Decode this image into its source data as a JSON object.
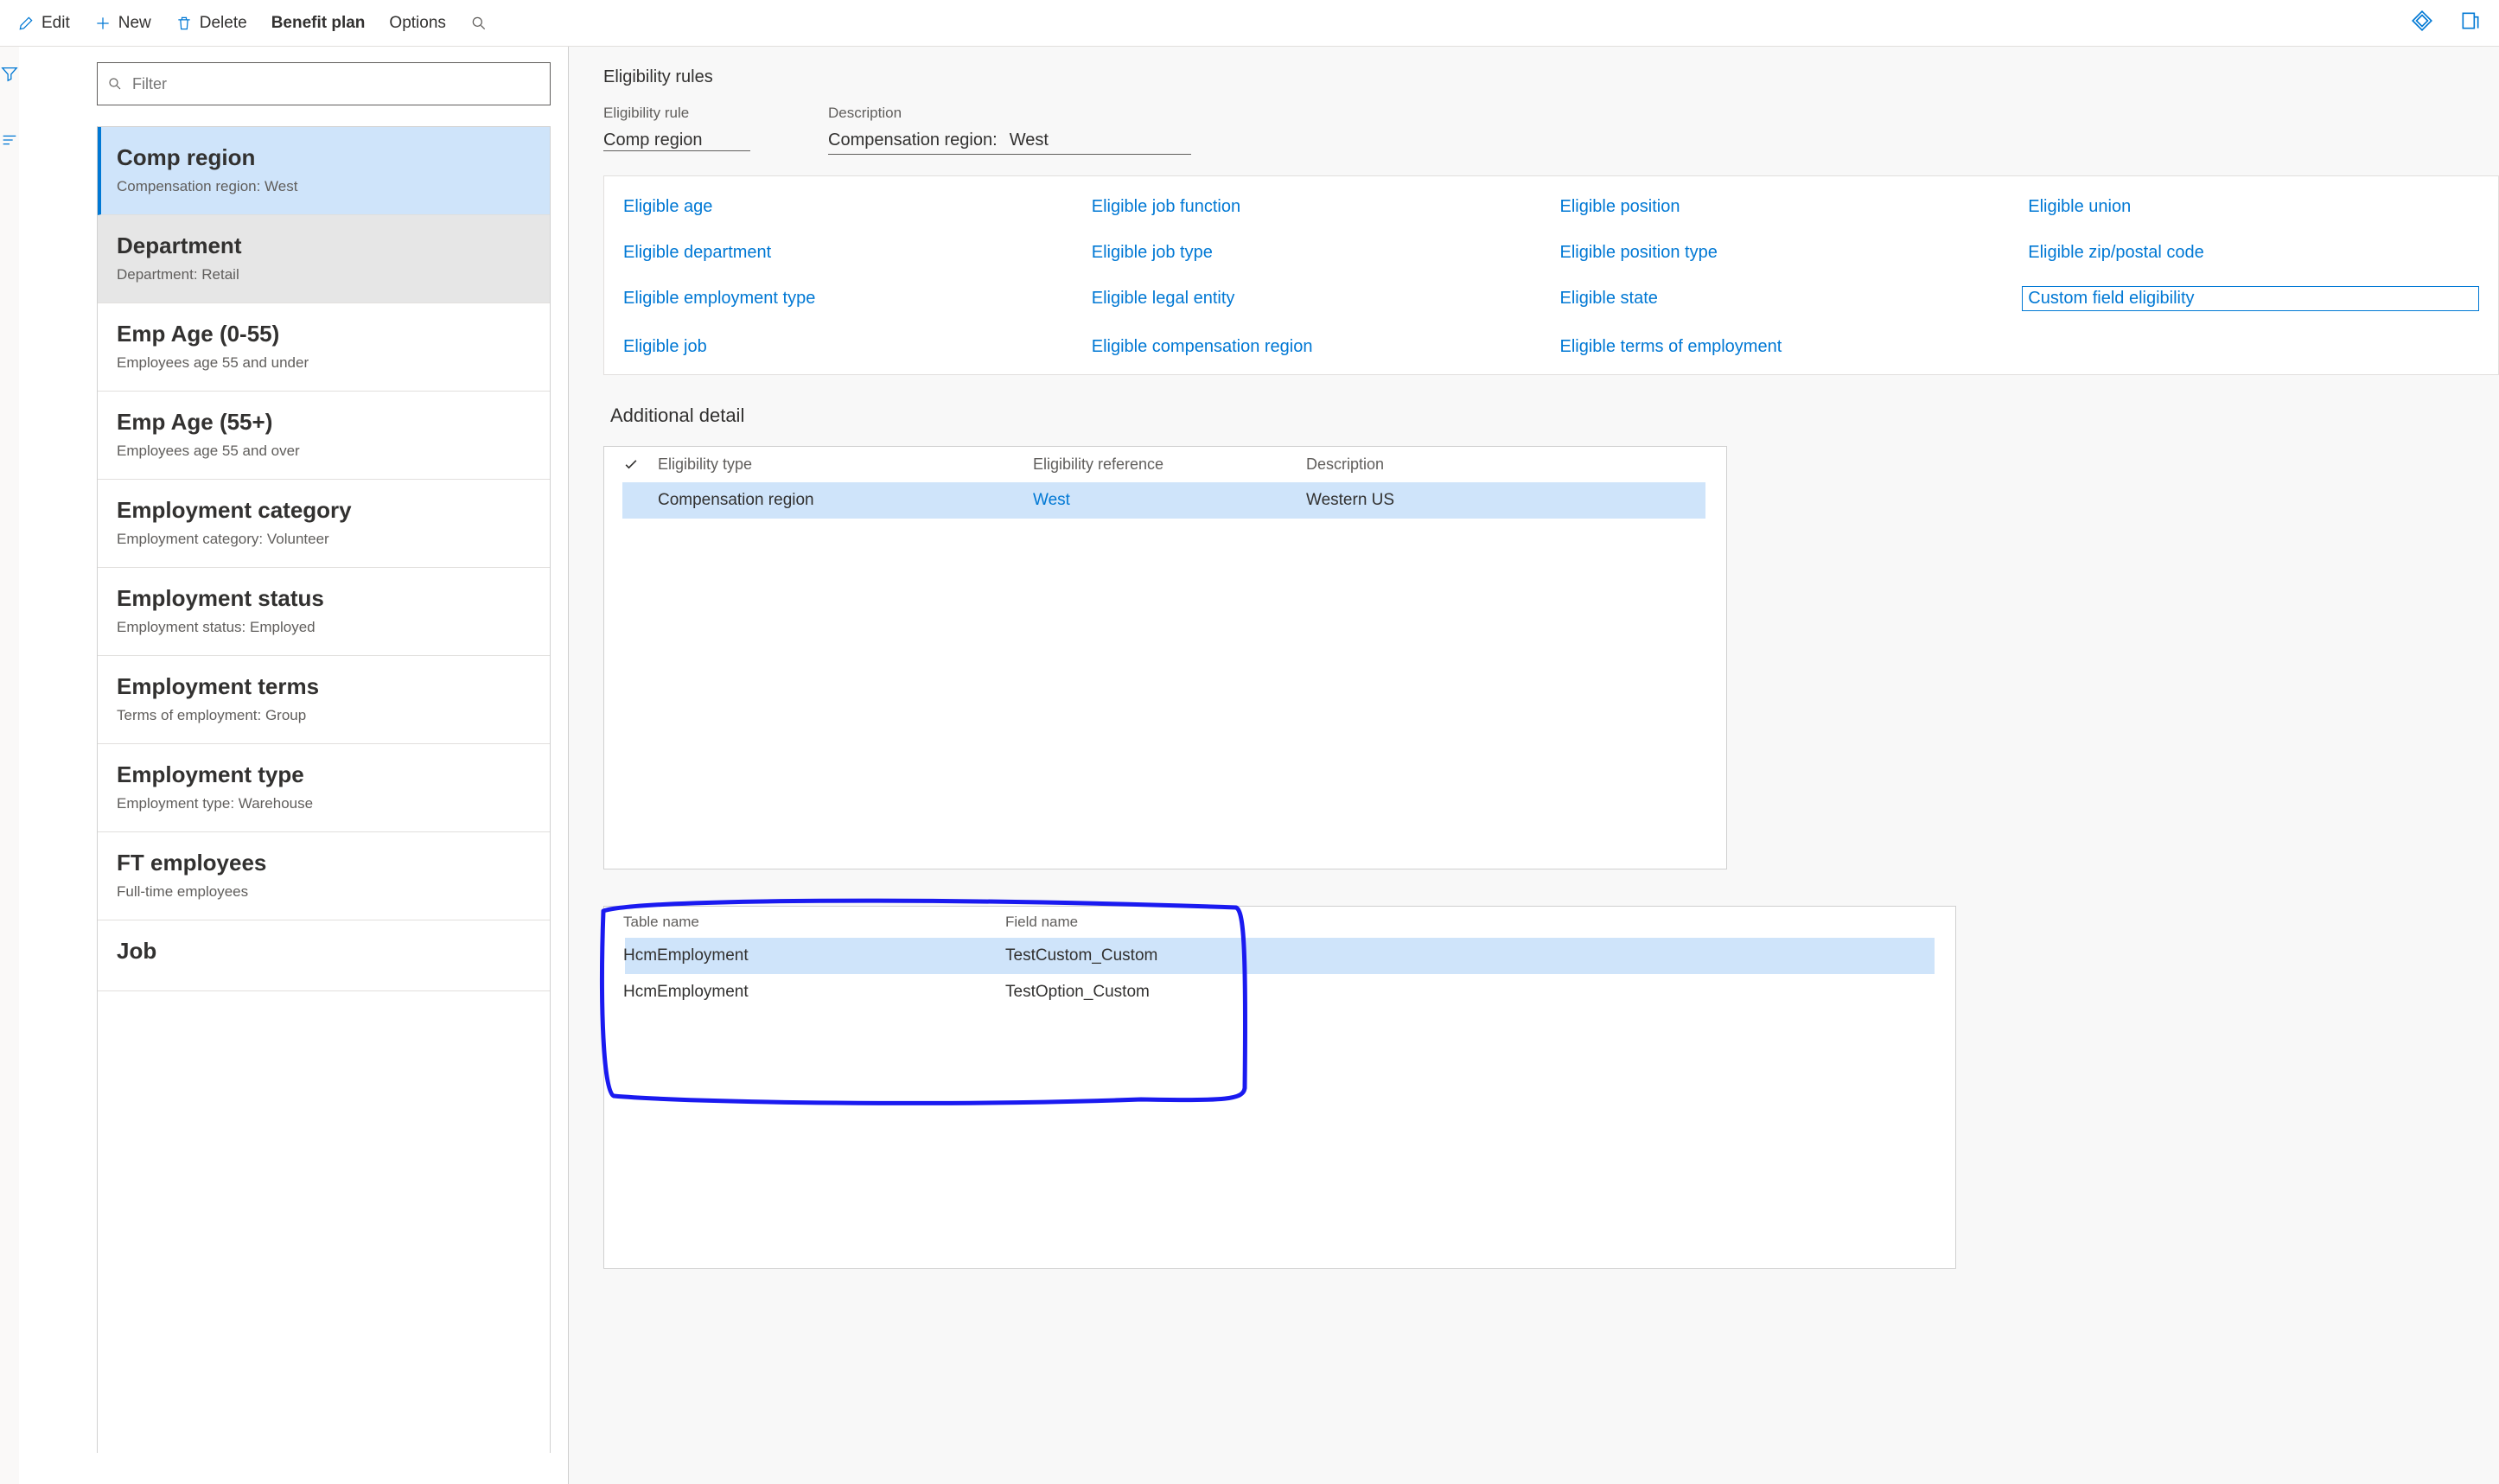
{
  "cmd": {
    "edit": "Edit",
    "new": "New",
    "delete": "Delete",
    "benefit_plan": "Benefit plan",
    "options": "Options"
  },
  "filter_placeholder": "Filter",
  "list": [
    {
      "title": "Comp region",
      "sub": "Compensation region:  West"
    },
    {
      "title": "Department",
      "sub": "Department:  Retail"
    },
    {
      "title": "Emp Age (0-55)",
      "sub": "Employees age 55 and under"
    },
    {
      "title": "Emp Age (55+)",
      "sub": "Employees age 55 and over"
    },
    {
      "title": "Employment category",
      "sub": "Employment category:  Volunteer"
    },
    {
      "title": "Employment status",
      "sub": "Employment status: Employed"
    },
    {
      "title": "Employment terms",
      "sub": "Terms of employment: Group"
    },
    {
      "title": "Employment type",
      "sub": "Employment type: Warehouse"
    },
    {
      "title": "FT employees",
      "sub": "Full-time employees"
    },
    {
      "title": "Job",
      "sub": ""
    }
  ],
  "sections": {
    "eligibility_rules": "Eligibility rules",
    "additional_detail": "Additional detail"
  },
  "header_fields": {
    "rule_label": "Eligibility rule",
    "rule_value": "Comp region",
    "desc_label": "Description",
    "desc_key": "Compensation region:",
    "desc_val": "West"
  },
  "tabs": {
    "r0c0": "Eligible age",
    "r0c1": "Eligible job function",
    "r0c2": "Eligible position",
    "r0c3": "Eligible union",
    "r1c0": "Eligible department",
    "r1c1": "Eligible job type",
    "r1c2": "Eligible position type",
    "r1c3": "Eligible zip/postal code",
    "r2c0": "Eligible employment type",
    "r2c1": "Eligible legal entity",
    "r2c2": "Eligible state",
    "r2c3": "Custom field eligibility",
    "r3c0": "Eligible job",
    "r3c1": "Eligible compensation region",
    "r3c2": "Eligible terms of employment"
  },
  "detail_table": {
    "h1": "Eligibility type",
    "h2": "Eligibility reference",
    "h3": "Description",
    "row": {
      "c1": "Compensation region",
      "c2": "West",
      "c3": "Western US"
    }
  },
  "custom_table": {
    "h1": "Table name",
    "h2": "Field name",
    "rows": [
      {
        "t1": "HcmEmployment",
        "t2": "TestCustom_Custom"
      },
      {
        "t1": "HcmEmployment",
        "t2": "TestOption_Custom"
      }
    ]
  }
}
